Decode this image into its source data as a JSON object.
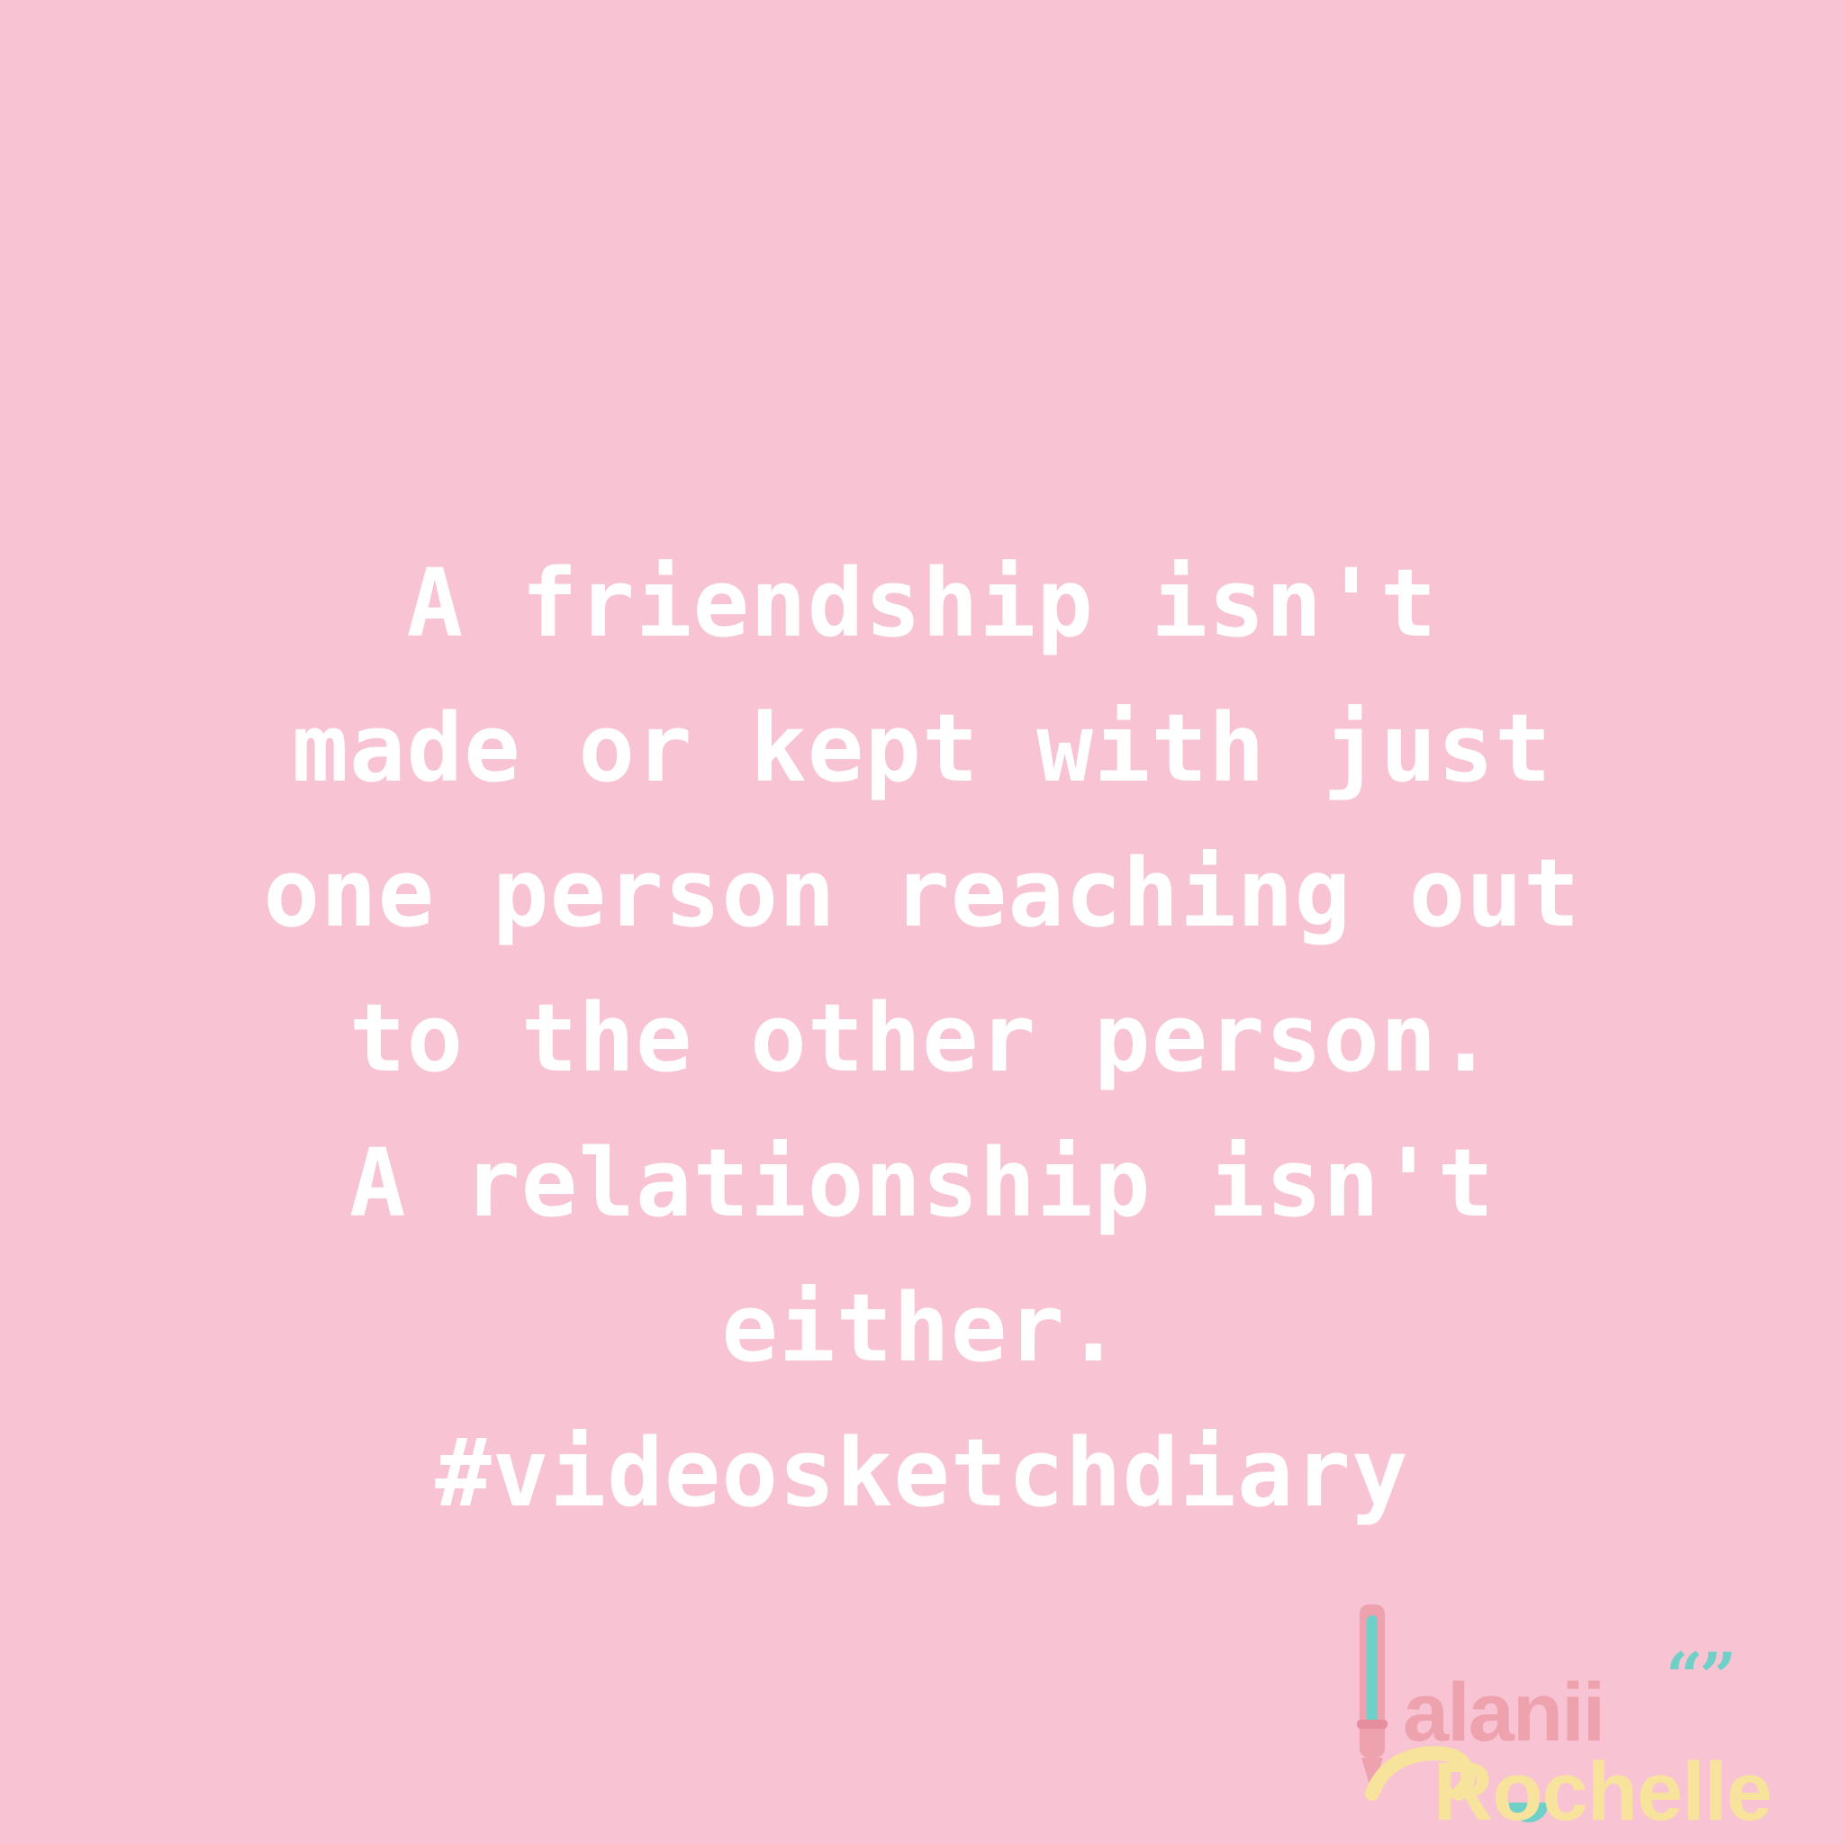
{
  "quote": {
    "text": "A friendship isn't\nmade or kept with just\none person reaching out\nto the other person.\nA relationship isn't\neither.\n#videosketchdiary"
  },
  "logo": {
    "icon": "pen-icon",
    "quote_marks": "“”",
    "word_1": "alanii",
    "word_2": "Rochelle",
    "colors": {
      "pink": "#eda2ae",
      "yellow": "#f7e39c",
      "teal": "#6fd0c8"
    }
  },
  "colors": {
    "background": "#f8c3d3",
    "text": "#ffffff"
  }
}
